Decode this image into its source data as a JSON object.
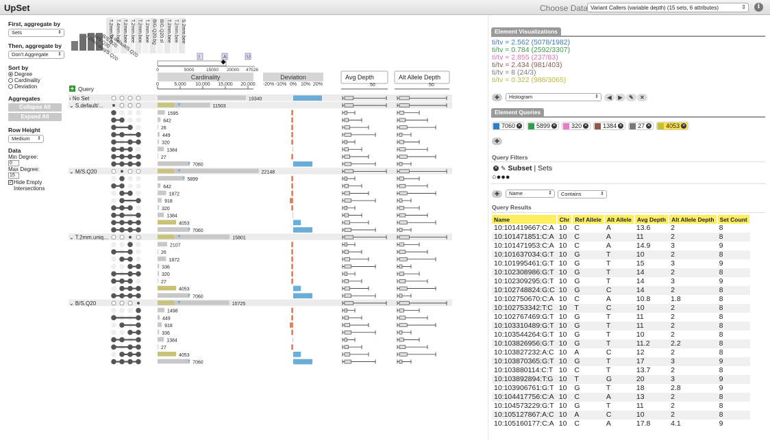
{
  "app": {
    "title": "UpSet",
    "choose_dataset_label": "Choose Dataset",
    "dataset_value": "Variant Callers (variable depth) (15 sets, 6 attributes)"
  },
  "left": {
    "first_aggregate_label": "First, aggregate by",
    "first_aggregate_value": "Sets",
    "then_aggregate_label": "Then, aggregate by",
    "then_aggregate_value": "Don't Aggregate",
    "sort_by_label": "Sort by",
    "sort_options": [
      {
        "label": "Degree",
        "checked": true
      },
      {
        "label": "Cardinality",
        "checked": false
      },
      {
        "label": "Deviation",
        "checked": false
      }
    ],
    "aggregates_label": "Aggregates",
    "collapse_all": "Collapse All",
    "expand_all": "Expand All",
    "row_height_label": "Row Height",
    "row_height_value": "Medium",
    "data_label": "Data",
    "min_degree_label": "Min Degree:",
    "min_degree_value": "0",
    "max_degree_label": "Max Degree:",
    "max_degree_value": "15",
    "hide_empty_label": "Hide Empty Intersections"
  },
  "matrix": {
    "set_names": [
      "S.default/...",
      "T.2mm.uniq",
      "M/S.Q20",
      "B/S.Q20",
      "T.2mm.bee",
      "T.4mm.bee",
      "T.2mm.bee",
      "T.2mm.bee",
      "T.2mm.bee",
      "T.2mm.bee",
      "BIG.Q20.bg",
      "BIG.Q20.sl",
      "T.2mm.bee",
      "T.2mm.bee",
      "S.2mm.bee"
    ],
    "rotated_set_labels": [
      "T.2mm.uniq/S.Q20",
      "M/S.Q20",
      "B/S.Q20",
      "S.default/S.Q20"
    ],
    "set_size_bars": [
      40,
      70,
      74,
      74
    ],
    "query_button": "Query",
    "cardinality_header": "Cardinality",
    "cardinality_ticks": [
      "0",
      "5,000",
      "10,000",
      "15,000",
      "20,000"
    ],
    "overview_ticks": [
      "0",
      "5000",
      "15000",
      "20000",
      "47526"
    ],
    "overview_markers": [
      "I",
      "A",
      "U"
    ],
    "deviation_header": "Deviation",
    "deviation_ticks": [
      "-20%",
      "-10%",
      "0%",
      "10%",
      "20%"
    ],
    "avg_depth_header": "Avg Depth",
    "avg_depth_tick": "50",
    "alt_allele_header": "Alt Allele Depth",
    "alt_allele_tick": "50",
    "colors": {
      "yellow": "#c8c276",
      "blue": "#6badd6",
      "orange": "#f07f4d",
      "gray": "#c8c8c8",
      "pink": "#f080c0"
    },
    "groups": [
      {
        "label": "No Set",
        "count": "19340",
        "card": 19340,
        "dots": [
          0,
          0,
          0,
          0
        ],
        "dev": 15,
        "children": []
      },
      {
        "label": "S.default/...",
        "count": "11503",
        "card": 11503,
        "dots": [
          1,
          0,
          0,
          0
        ],
        "dev": 0,
        "children": [
          {
            "count": "1595",
            "card": 1595,
            "dots": [
              1,
              0,
              0,
              0
            ],
            "dev": -1
          },
          {
            "count": "642",
            "card": 642,
            "dots": [
              1,
              1,
              0,
              0
            ],
            "dev": -1
          },
          {
            "count": "26",
            "card": 26,
            "dots": [
              1,
              0,
              1,
              0
            ],
            "dev": -1
          },
          {
            "count": "449",
            "card": 449,
            "dots": [
              1,
              1,
              0,
              1
            ],
            "dev": -1
          },
          {
            "count": "320",
            "card": 320,
            "dots": [
              1,
              0,
              1,
              1
            ],
            "dev": -1
          },
          {
            "count": "1384",
            "card": 1384,
            "dots": [
              1,
              1,
              1,
              0
            ],
            "dev": -0.2
          },
          {
            "count": "27",
            "card": 27,
            "dots": [
              1,
              1,
              1,
              1
            ],
            "dev": -1
          },
          {
            "count": "7060",
            "card": 7060,
            "dots": [
              1,
              1,
              1,
              1
            ],
            "dev": 10
          }
        ]
      },
      {
        "label": "M/S.Q20",
        "count": "22148",
        "card": 22148,
        "dots": [
          0,
          1,
          0,
          0
        ],
        "dev": 0,
        "children": [
          {
            "count": "5899",
            "card": 5899,
            "dots": [
              0,
              1,
              0,
              0
            ],
            "dev": -1
          },
          {
            "count": "642",
            "card": 642,
            "dots": [
              1,
              1,
              0,
              0
            ],
            "dev": -1
          },
          {
            "count": "1872",
            "card": 1872,
            "dots": [
              0,
              1,
              1,
              0
            ],
            "dev": -1
          },
          {
            "count": "918",
            "card": 918,
            "dots": [
              0,
              1,
              0,
              1
            ],
            "dev": -1.8
          },
          {
            "count": "320",
            "card": 320,
            "dots": [
              1,
              1,
              1,
              0
            ],
            "dev": -1
          },
          {
            "count": "1384",
            "card": 1384,
            "dots": [
              1,
              1,
              0,
              1
            ],
            "dev": -0.2
          },
          {
            "count": "4053",
            "card": 4053,
            "dots": [
              1,
              1,
              1,
              1
            ],
            "dev": 4
          },
          {
            "count": "7060",
            "card": 7060,
            "dots": [
              1,
              1,
              1,
              1
            ],
            "dev": 10
          }
        ]
      },
      {
        "label": "T.2mm.uniq...",
        "count": "15801",
        "card": 15801,
        "dots": [
          0,
          0,
          1,
          0
        ],
        "dev": 0,
        "children": [
          {
            "count": "2107",
            "card": 2107,
            "dots": [
              0,
              0,
              1,
              0
            ],
            "dev": -1
          },
          {
            "count": "26",
            "card": 26,
            "dots": [
              1,
              0,
              1,
              0
            ],
            "dev": -1
          },
          {
            "count": "1872",
            "card": 1872,
            "dots": [
              0,
              1,
              1,
              0
            ],
            "dev": -1
          },
          {
            "count": "336",
            "card": 336,
            "dots": [
              0,
              0,
              1,
              1
            ],
            "dev": -1
          },
          {
            "count": "320",
            "card": 320,
            "dots": [
              1,
              0,
              1,
              1
            ],
            "dev": -1
          },
          {
            "count": "27",
            "card": 27,
            "dots": [
              1,
              1,
              1,
              0
            ],
            "dev": -1
          },
          {
            "count": "4053",
            "card": 4053,
            "dots": [
              0,
              1,
              1,
              1
            ],
            "dev": 4
          },
          {
            "count": "7060",
            "card": 7060,
            "dots": [
              1,
              1,
              1,
              1
            ],
            "dev": 10
          }
        ]
      },
      {
        "label": "B/S.Q20",
        "count": "15725",
        "card": 15725,
        "dots": [
          0,
          0,
          0,
          1
        ],
        "dev": 0,
        "children": [
          {
            "count": "1498",
            "card": 1498,
            "dots": [
              0,
              0,
              0,
              1
            ],
            "dev": -1
          },
          {
            "count": "449",
            "card": 449,
            "dots": [
              1,
              0,
              0,
              1
            ],
            "dev": -1
          },
          {
            "count": "918",
            "card": 918,
            "dots": [
              0,
              1,
              0,
              1
            ],
            "dev": -1.8
          },
          {
            "count": "336",
            "card": 336,
            "dots": [
              0,
              0,
              1,
              1
            ],
            "dev": -1
          },
          {
            "count": "1384",
            "card": 1384,
            "dots": [
              1,
              1,
              0,
              1
            ],
            "dev": -0.2
          },
          {
            "count": "27",
            "card": 27,
            "dots": [
              1,
              0,
              1,
              1
            ],
            "dev": -1
          },
          {
            "count": "4053",
            "card": 4053,
            "dots": [
              0,
              1,
              1,
              1
            ],
            "dev": 4
          },
          {
            "count": "7060",
            "card": 7060,
            "dots": [
              1,
              1,
              1,
              1
            ],
            "dev": 10
          }
        ]
      }
    ]
  },
  "right": {
    "element_vis_tab": "Element Visualizations",
    "titv": [
      {
        "text": "ti/tv = 2.562 (5078/1982)",
        "color": "#3b7bbd"
      },
      {
        "text": "ti/tv = 0.784 (2592/3307)",
        "color": "#37a045"
      },
      {
        "text": "ti/tv = 2.855 (237/83)",
        "color": "#e070b8"
      },
      {
        "text": "ti/tv = 2.434 (981/403)",
        "color": "#8a5a48"
      },
      {
        "text": "ti/tv = 8 (24/3)",
        "color": "#7a7a7a"
      },
      {
        "text": "ti/tv = 0.322 (988/3065)",
        "color": "#bcb83c"
      }
    ],
    "vis_select": "Histogram",
    "element_queries_tab": "Element Queries",
    "queries": [
      {
        "label": "7060",
        "color": "#2f7dc2"
      },
      {
        "label": "5899",
        "color": "#2fa04a"
      },
      {
        "label": "320",
        "color": "#e67cc3"
      },
      {
        "label": "1384",
        "color": "#8c5a48"
      },
      {
        "label": "27",
        "color": "#7a7a7a"
      },
      {
        "label": "4053",
        "color": "#c4c033"
      }
    ],
    "query_filters_label": "Query Filters",
    "filter_subset": "Subset",
    "filter_sets": "| Sets",
    "filter_field": "Name",
    "filter_op": "Contains",
    "query_results_label": "Query Results",
    "columns": [
      "Name",
      "Chr",
      "Ref Allele",
      "Alt Allele",
      "Avg Depth",
      "Alt Allele Depth",
      "Set Count"
    ],
    "rows": [
      [
        "10:101419667:C:A",
        "10",
        "C",
        "A",
        "13.6",
        "2",
        "8"
      ],
      [
        "10:101471851:C:A",
        "10",
        "C",
        "A",
        "11",
        "2",
        "8"
      ],
      [
        "10:101471953:C:A",
        "10",
        "C",
        "A",
        "14.9",
        "3",
        "9"
      ],
      [
        "10:101637034:G:T",
        "10",
        "G",
        "T",
        "10",
        "2",
        "8"
      ],
      [
        "10:101995461:G:T",
        "10",
        "G",
        "T",
        "15",
        "3",
        "9"
      ],
      [
        "10:102308986:G:T",
        "10",
        "G",
        "T",
        "14",
        "2",
        "8"
      ],
      [
        "10:102309295:G:T",
        "10",
        "G",
        "T",
        "14",
        "3",
        "9"
      ],
      [
        "10:102748824:G:C",
        "10",
        "G",
        "C",
        "14",
        "2",
        "8"
      ],
      [
        "10:102750670:C:A",
        "10",
        "C",
        "A",
        "10.8",
        "1.8",
        "8"
      ],
      [
        "10:102753342:T:C",
        "10",
        "T",
        "C",
        "10",
        "2",
        "8"
      ],
      [
        "10:102767469:G:T",
        "10",
        "G",
        "T",
        "11",
        "2",
        "8"
      ],
      [
        "10:103310489:G:T",
        "10",
        "G",
        "T",
        "11",
        "2",
        "8"
      ],
      [
        "10:103544264:G:T",
        "10",
        "G",
        "T",
        "10",
        "2",
        "8"
      ],
      [
        "10:103826956:G:T",
        "10",
        "G",
        "T",
        "11.2",
        "2.2",
        "8"
      ],
      [
        "10:103827232:A:C",
        "10",
        "A",
        "C",
        "12",
        "2",
        "8"
      ],
      [
        "10:103870365:G:T",
        "10",
        "G",
        "T",
        "17",
        "3",
        "9"
      ],
      [
        "10:103880114:C:T",
        "10",
        "C",
        "T",
        "13.7",
        "2",
        "8"
      ],
      [
        "10:103892894:T:G",
        "10",
        "T",
        "G",
        "20",
        "3",
        "9"
      ],
      [
        "10:103906761:G:T",
        "10",
        "G",
        "T",
        "18",
        "2.8",
        "9"
      ],
      [
        "10:104417756:C:A",
        "10",
        "C",
        "A",
        "13",
        "2",
        "8"
      ],
      [
        "10:104573229:G:T",
        "10",
        "G",
        "T",
        "11",
        "2",
        "8"
      ],
      [
        "10:105127867:A:C",
        "10",
        "A",
        "C",
        "10",
        "2",
        "8"
      ],
      [
        "10:105160177:C:A",
        "10",
        "C",
        "A",
        "17.8",
        "4.1",
        "9"
      ]
    ]
  }
}
